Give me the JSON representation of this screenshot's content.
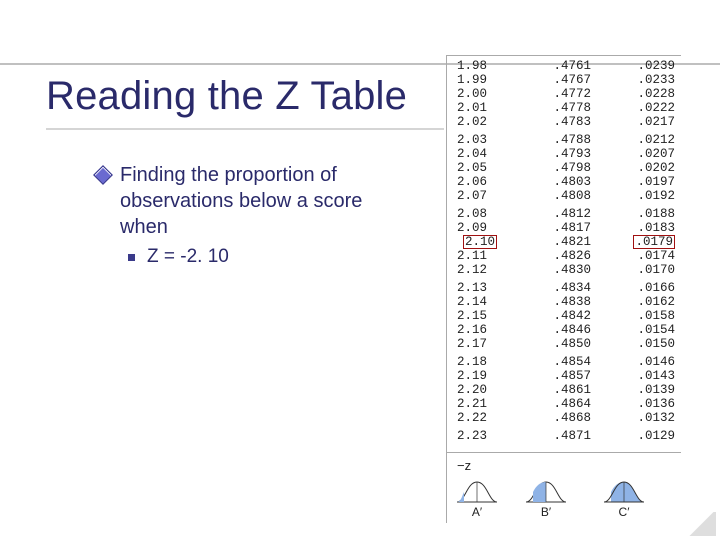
{
  "title": "Reading the Z Table",
  "body": {
    "bullet1": "Finding the proportion of observations below a score when",
    "sub1": "Z = -2. 10"
  },
  "ztable": {
    "highlight_z": "2.10",
    "groups": [
      [
        {
          "z": "1.98",
          "b": ".4761",
          "c": ".0239"
        },
        {
          "z": "1.99",
          "b": ".4767",
          "c": ".0233"
        },
        {
          "z": "2.00",
          "b": ".4772",
          "c": ".0228"
        },
        {
          "z": "2.01",
          "b": ".4778",
          "c": ".0222"
        },
        {
          "z": "2.02",
          "b": ".4783",
          "c": ".0217"
        }
      ],
      [
        {
          "z": "2.03",
          "b": ".4788",
          "c": ".0212"
        },
        {
          "z": "2.04",
          "b": ".4793",
          "c": ".0207"
        },
        {
          "z": "2.05",
          "b": ".4798",
          "c": ".0202"
        },
        {
          "z": "2.06",
          "b": ".4803",
          "c": ".0197"
        },
        {
          "z": "2.07",
          "b": ".4808",
          "c": ".0192"
        }
      ],
      [
        {
          "z": "2.08",
          "b": ".4812",
          "c": ".0188"
        },
        {
          "z": "2.09",
          "b": ".4817",
          "c": ".0183"
        },
        {
          "z": "2.10",
          "b": ".4821",
          "c": ".0179"
        },
        {
          "z": "2.11",
          "b": ".4826",
          "c": ".0174"
        },
        {
          "z": "2.12",
          "b": ".4830",
          "c": ".0170"
        }
      ],
      [
        {
          "z": "2.13",
          "b": ".4834",
          "c": ".0166"
        },
        {
          "z": "2.14",
          "b": ".4838",
          "c": ".0162"
        },
        {
          "z": "2.15",
          "b": ".4842",
          "c": ".0158"
        },
        {
          "z": "2.16",
          "b": ".4846",
          "c": ".0154"
        },
        {
          "z": "2.17",
          "b": ".4850",
          "c": ".0150"
        }
      ],
      [
        {
          "z": "2.18",
          "b": ".4854",
          "c": ".0146"
        },
        {
          "z": "2.19",
          "b": ".4857",
          "c": ".0143"
        },
        {
          "z": "2.20",
          "b": ".4861",
          "c": ".0139"
        },
        {
          "z": "2.21",
          "b": ".4864",
          "c": ".0136"
        },
        {
          "z": "2.22",
          "b": ".4868",
          "c": ".0132"
        }
      ],
      [
        {
          "z": "2.23",
          "b": ".4871",
          "c": ".0129"
        }
      ]
    ],
    "footer": {
      "minus_z": "−z",
      "labels": [
        "A′",
        "B′",
        "C′"
      ]
    }
  },
  "chart_data": [
    {
      "type": "area",
      "title": "A′",
      "x": [
        -3,
        -2,
        -1,
        0,
        1,
        2,
        3
      ],
      "values": [
        0.004,
        0.054,
        0.242,
        0.399,
        0.242,
        0.054,
        0.004
      ],
      "shaded_region": "left-tail",
      "shaded_up_to": -2.1,
      "xlabel": "",
      "ylabel": ""
    },
    {
      "type": "area",
      "title": "B′",
      "x": [
        -3,
        -2,
        -1,
        0,
        1,
        2,
        3
      ],
      "values": [
        0.004,
        0.054,
        0.242,
        0.399,
        0.242,
        0.054,
        0.004
      ],
      "shaded_region": "between -z and 0",
      "shaded_from": -2.1,
      "shaded_to": 0,
      "xlabel": "",
      "ylabel": ""
    },
    {
      "type": "area",
      "title": "C′",
      "x": [
        -3,
        -2,
        -1,
        0,
        1,
        2,
        3
      ],
      "values": [
        0.004,
        0.054,
        0.242,
        0.399,
        0.242,
        0.054,
        0.004
      ],
      "shaded_region": "right-of -z (body)",
      "shaded_from": -2.1,
      "xlabel": "",
      "ylabel": ""
    }
  ]
}
